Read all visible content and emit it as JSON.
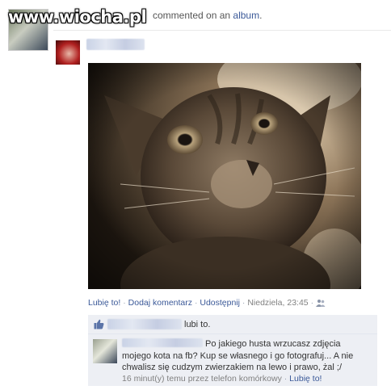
{
  "watermark": "www.wiocha.pl",
  "story": {
    "action_text": "commented on an",
    "album_link": "album",
    "album_suffix": "."
  },
  "photo": {
    "alt": "Sepia kitten photo"
  },
  "actions": {
    "like": "Lubię to!",
    "comment": "Dodaj komentarz",
    "share": "Udostępnij",
    "timestamp": "Niedziela, 23:45",
    "dot": "·"
  },
  "likes_bar": {
    "text": "lubi to."
  },
  "comment": {
    "text": "Po jakiego husta wrzucasz zdjęcia mojego kota na fb? Kup se własnego i go fotografuj... A nie chwalisz się cudzym zwierzakiem na lewo i prawo, żal ;/",
    "meta": "16 minut(y) temu przez telefon komórkowy",
    "like": "Lubię to!"
  },
  "colors": {
    "link": "#3b5998",
    "comment_bg": "#edeff4",
    "border": "#d8dfea"
  }
}
